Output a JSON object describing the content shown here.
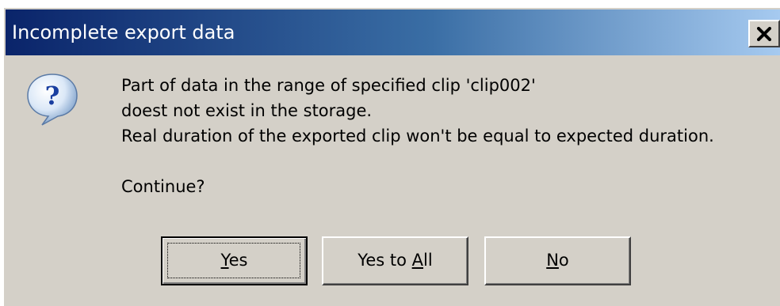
{
  "dialog": {
    "title": "Incomplete export data",
    "close_glyph": "✕",
    "icon": "question-icon",
    "message": {
      "line1": "Part of data in the range of specified clip 'clip002'",
      "line2": "doest not exist in the storage.",
      "line3": "Real duration of the exported clip won't be equal to expected duration.",
      "prompt": "Continue?"
    },
    "buttons": {
      "yes": {
        "mnemonic": "Y",
        "rest": "es"
      },
      "yes_to_all": {
        "prefix": "Yes to ",
        "mnemonic": "A",
        "rest": "ll"
      },
      "no": {
        "mnemonic": "N",
        "rest": "o"
      }
    }
  },
  "colors": {
    "titlebar_start": "#0a246a",
    "titlebar_end": "#a6caf0",
    "face": "#d4d0c8"
  }
}
